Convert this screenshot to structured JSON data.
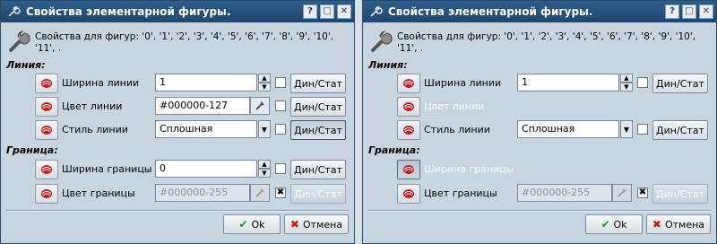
{
  "title": "Свойства элементарной фигуры.",
  "titlebar_buttons": {
    "help": "?",
    "maximize": "□",
    "close": "✕"
  },
  "header": {
    "text": "Свойства для фигур: '0', '1', '2', '3', '4', '5', '6', '7', '8', '9', '10', '11', ."
  },
  "sections": {
    "lines": "Линия:",
    "border": "Граница:"
  },
  "labels": {
    "line_width": "Ширина линии",
    "line_color": "Цвет линии",
    "line_style": "Стиль линии",
    "border_width": "Ширина границы",
    "border_color": "Цвет границы"
  },
  "dyn_stat": "Дин/Стат",
  "values": {
    "line_width": "1",
    "line_color": "#000000-127",
    "line_style": "Сплошная",
    "border_width": "0",
    "border_color": "#000000-255"
  },
  "buttons": {
    "ok": "Ok",
    "cancel": "Отмена"
  },
  "icons": {
    "app": "wrench-icon",
    "edit": "edit-icon",
    "picker": "color-picker-icon",
    "ok": "check-icon",
    "cancel": "cancel-icon"
  },
  "colors": {
    "titlebar": "#1f4670",
    "dialog_bg": "#c8d4de",
    "accent_red": "#d01818",
    "ok_green": "#1a9a1a"
  }
}
